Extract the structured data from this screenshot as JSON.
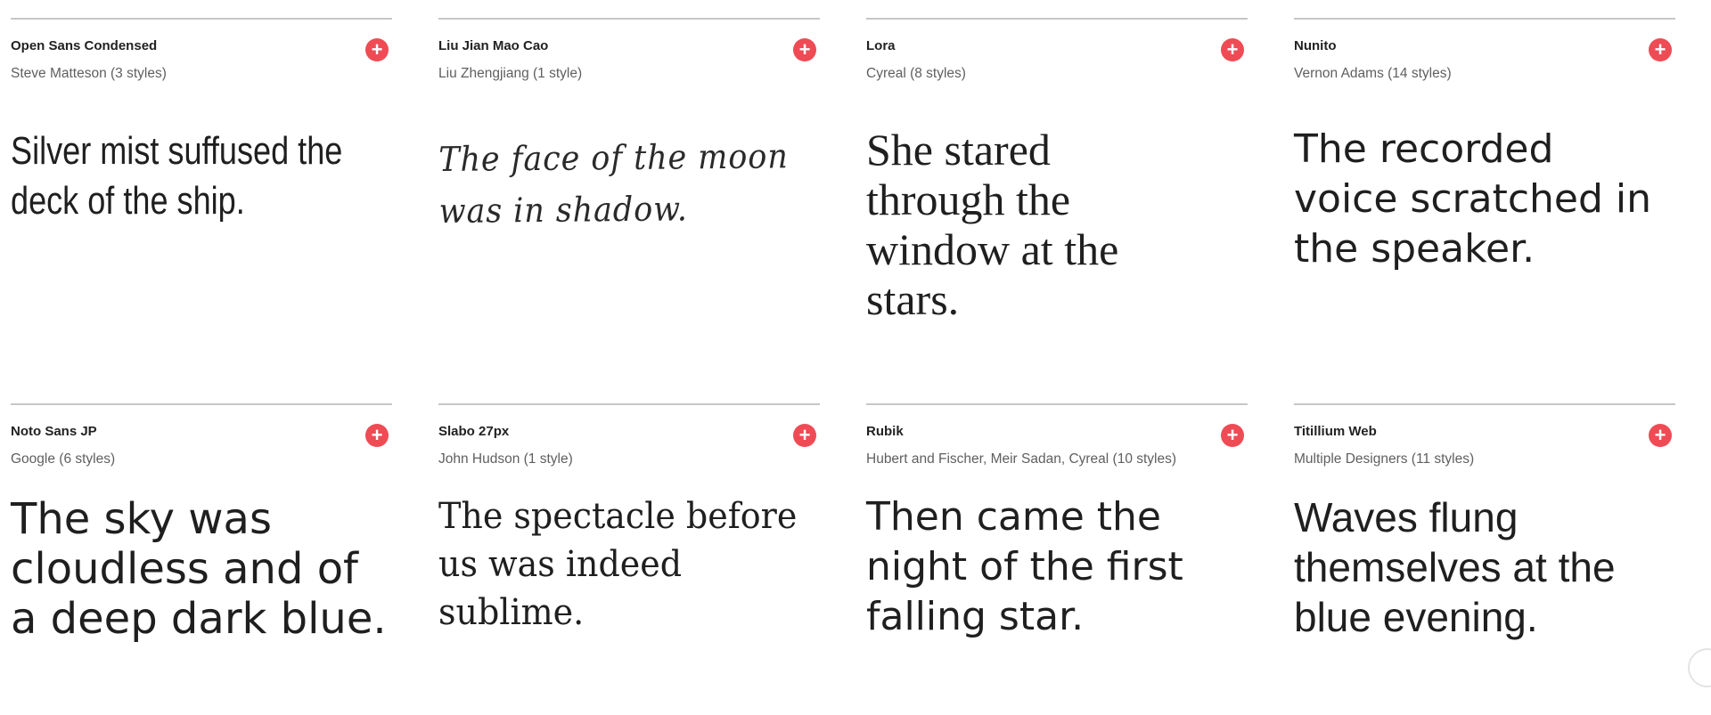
{
  "fonts": [
    {
      "name": "Open Sans Condensed",
      "designer": "Steve Matteson (3 styles)",
      "sample": "Silver mist suffused the\ndeck of the ship.",
      "add_icon": "+"
    },
    {
      "name": "Liu Jian Mao Cao",
      "designer": "Liu Zhengjiang (1 style)",
      "sample": "The face of the moon\nwas in shadow.",
      "add_icon": "+"
    },
    {
      "name": "Lora",
      "designer": "Cyreal (8 styles)",
      "sample": "She stared\nthrough the\nwindow at the\nstars.",
      "add_icon": "+"
    },
    {
      "name": "Nunito",
      "designer": "Vernon Adams (14 styles)",
      "sample": "The recorded\nvoice scratched in\nthe speaker.",
      "add_icon": "+"
    },
    {
      "name": "Noto Sans JP",
      "designer": "Google (6 styles)",
      "sample": "The sky was\ncloudless and of\na deep dark blue.",
      "add_icon": "+"
    },
    {
      "name": "Slabo 27px",
      "designer": "John Hudson (1 style)",
      "sample": "The spectacle before\nus was indeed\nsublime.",
      "add_icon": "+"
    },
    {
      "name": "Rubik",
      "designer": "Hubert and Fischer, Meir Sadan, Cyreal (10 styles)",
      "sample": "Then came the\nnight of the first\nfalling star.",
      "add_icon": "+"
    },
    {
      "name": "Titillium Web",
      "designer": "Multiple Designers (11 styles)",
      "sample": "Waves flung\nthemselves at the\nblue evening.",
      "add_icon": "+"
    }
  ],
  "colors": {
    "accent": "#ef4b55",
    "divider": "#c6c6c6",
    "secondary_text": "#5f5f5f"
  },
  "icons": {
    "add": "plus-circle-icon"
  }
}
